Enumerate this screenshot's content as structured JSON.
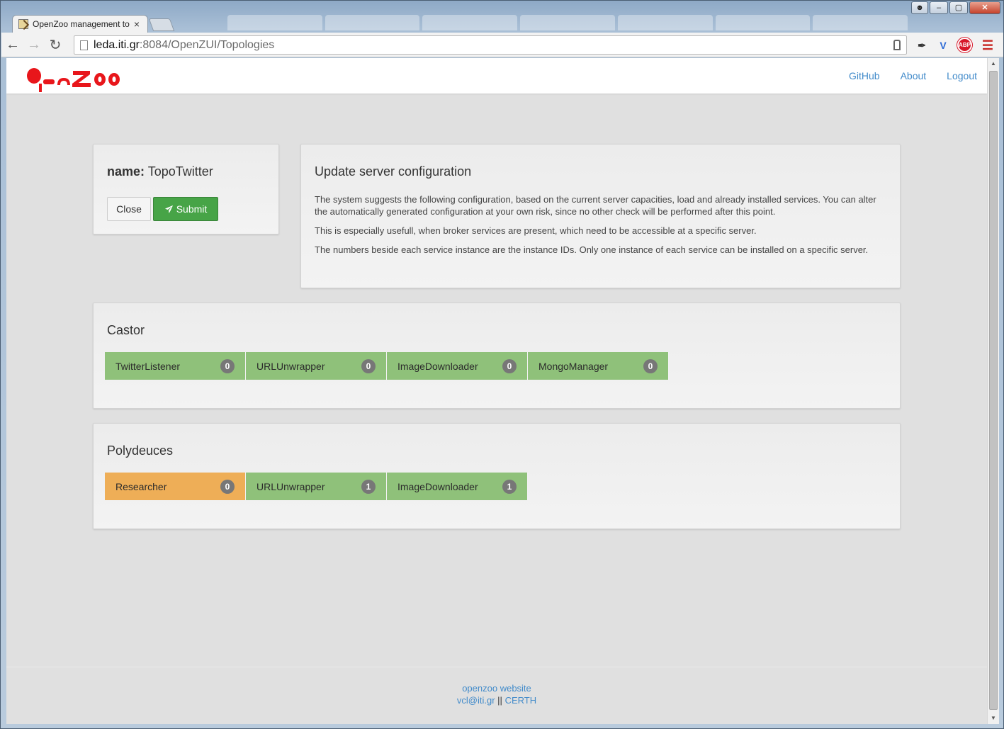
{
  "browser": {
    "tab_title": "OpenZoo management to",
    "tab_close": "×",
    "url_host": "leda.iti.gr",
    "url_rest": ":8084/OpenZUI/Topologies",
    "abp_label": "ABP",
    "back_icon": "back-arrow-icon",
    "forward_icon": "forward-arrow-icon",
    "reload_icon": "reload-icon"
  },
  "navbar": {
    "logo_alt": "OpenZoo",
    "links": [
      "GitHub",
      "About",
      "Logout"
    ]
  },
  "topology": {
    "name_label": "name:",
    "name_value": "TopoTwitter",
    "close_label": "Close",
    "submit_label": "Submit"
  },
  "info": {
    "title": "Update server configuration",
    "paragraphs": [
      "The system suggests the following configuration, based on the current server capacities, load and already installed services. You can alter the automatically generated configuration at your own risk, since no other check will be performed after this point.",
      "This is especially usefull, when broker services are present, which need to be accessible at a specific server.",
      "The numbers beside each service instance are the instance IDs. Only one instance of each service can be installed on a specific server."
    ]
  },
  "servers": [
    {
      "name": "Castor",
      "services": [
        {
          "name": "TwitterListener",
          "id": "0",
          "color": "#8fc17a"
        },
        {
          "name": "URLUnwrapper",
          "id": "0",
          "color": "#8fc17a"
        },
        {
          "name": "ImageDownloader",
          "id": "0",
          "color": "#8fc17a"
        },
        {
          "name": "MongoManager",
          "id": "0",
          "color": "#8fc17a"
        }
      ]
    },
    {
      "name": "Polydeuces",
      "services": [
        {
          "name": "Researcher",
          "id": "0",
          "color": "#eeae57"
        },
        {
          "name": "URLUnwrapper",
          "id": "1",
          "color": "#8fc17a"
        },
        {
          "name": "ImageDownloader",
          "id": "1",
          "color": "#8fc17a"
        }
      ]
    }
  ],
  "footer": {
    "website": "openzoo website",
    "email": "vcl@iti.gr",
    "separator": "||",
    "org": "CERTH"
  },
  "colors": {
    "link": "#428bca",
    "submit": "#47a447",
    "service_ok": "#8fc17a",
    "service_warn": "#eeae57",
    "logo": "#e8161b"
  }
}
